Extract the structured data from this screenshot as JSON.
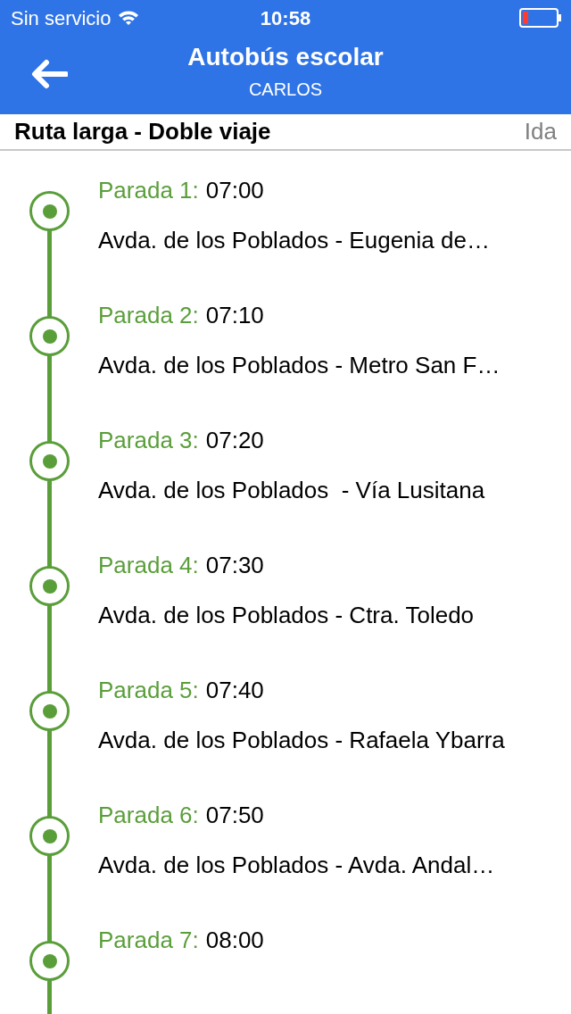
{
  "status_bar": {
    "carrier": "Sin servicio",
    "time": "10:58"
  },
  "header": {
    "title": "Autobús escolar",
    "subtitle": "CARLOS"
  },
  "route": {
    "name": "Ruta larga - Doble viaje",
    "direction": "Ida"
  },
  "stops": [
    {
      "label": "Parada 1:",
      "time": "07:00",
      "address": "Avda. de los Poblados - Eugenia de…"
    },
    {
      "label": "Parada 2:",
      "time": "07:10",
      "address": "Avda. de los Poblados - Metro San F…"
    },
    {
      "label": "Parada 3:",
      "time": "07:20",
      "address": "Avda. de los Poblados  - Vía Lusitana"
    },
    {
      "label": "Parada 4:",
      "time": "07:30",
      "address": "Avda. de los Poblados - Ctra. Toledo"
    },
    {
      "label": "Parada 5:",
      "time": "07:40",
      "address": "Avda. de los Poblados - Rafaela Ybarra"
    },
    {
      "label": "Parada 6:",
      "time": "07:50",
      "address": "Avda. de los Poblados - Avda. Andal…"
    },
    {
      "label": "Parada 7:",
      "time": "08:00"
    }
  ]
}
